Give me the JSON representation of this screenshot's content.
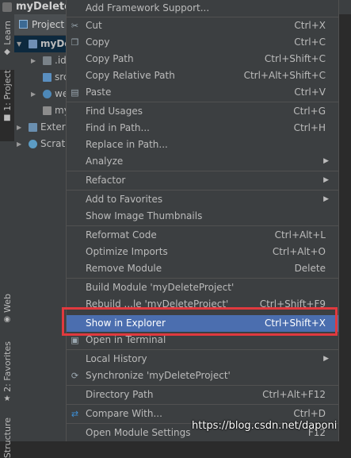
{
  "title": "myDeleteProject",
  "toolstrip": {
    "tabs": [
      {
        "label": "Learn"
      },
      {
        "label": "1: Project"
      },
      {
        "label": "Web"
      },
      {
        "label": "2: Favorites"
      },
      {
        "label": "Structure"
      }
    ]
  },
  "panel": {
    "header": "Project",
    "rows": [
      {
        "label": "myDeleteProject"
      },
      {
        "label": ".idea"
      },
      {
        "label": "src"
      },
      {
        "label": "web"
      },
      {
        "label": "myDeleteProject.iml"
      },
      {
        "label": "External Libraries"
      },
      {
        "label": "Scratches and Consoles"
      }
    ]
  },
  "menu": {
    "items": [
      {
        "label": "Add Framework Support...",
        "shortcut": ""
      },
      {
        "label": "Cut",
        "shortcut": "Ctrl+X",
        "icon": "cut-icon"
      },
      {
        "label": "Copy",
        "shortcut": "Ctrl+C",
        "icon": "copy-icon"
      },
      {
        "label": "Copy Path",
        "shortcut": "Ctrl+Shift+C"
      },
      {
        "label": "Copy Relative Path",
        "shortcut": "Ctrl+Alt+Shift+C"
      },
      {
        "label": "Paste",
        "shortcut": "Ctrl+V",
        "icon": "paste-icon"
      },
      {
        "label": "Find Usages",
        "shortcut": "Ctrl+G"
      },
      {
        "label": "Find in Path...",
        "shortcut": "Ctrl+H"
      },
      {
        "label": "Replace in Path...",
        "shortcut": ""
      },
      {
        "label": "Analyze",
        "shortcut": "",
        "submenu": true
      },
      {
        "label": "Refactor",
        "shortcut": "",
        "submenu": true
      },
      {
        "label": "Add to Favorites",
        "shortcut": "",
        "submenu": true
      },
      {
        "label": "Show Image Thumbnails",
        "shortcut": ""
      },
      {
        "label": "Reformat Code",
        "shortcut": "Ctrl+Alt+L"
      },
      {
        "label": "Optimize Imports",
        "shortcut": "Ctrl+Alt+O"
      },
      {
        "label": "Remove Module",
        "shortcut": "Delete"
      },
      {
        "label": "Build Module 'myDeleteProject'",
        "shortcut": ""
      },
      {
        "label": "Rebuild ...le 'myDeleteProject'",
        "shortcut": "Ctrl+Shift+F9"
      },
      {
        "label": "Show in Explorer",
        "shortcut": "Ctrl+Shift+X"
      },
      {
        "label": "Open in Terminal",
        "shortcut": "",
        "icon": "terminal-icon"
      },
      {
        "label": "Local History",
        "shortcut": "",
        "submenu": true
      },
      {
        "label": "Synchronize 'myDeleteProject'",
        "shortcut": "",
        "icon": "sync-icon"
      },
      {
        "label": "Directory Path",
        "shortcut": "Ctrl+Alt+F12"
      },
      {
        "label": "Compare With...",
        "shortcut": "Ctrl+D",
        "icon": "compare-icon"
      },
      {
        "label": "Open Module Settings",
        "shortcut": "F12"
      }
    ],
    "highlighted": "Show in Explorer"
  },
  "watermark": "https://blog.csdn.net/daponi",
  "colors": {
    "menu_bg": "#3c3f41",
    "highlight": "#4b6eaf",
    "annotation_box": "#e0393e",
    "editor_bg": "#2b2b2b"
  }
}
